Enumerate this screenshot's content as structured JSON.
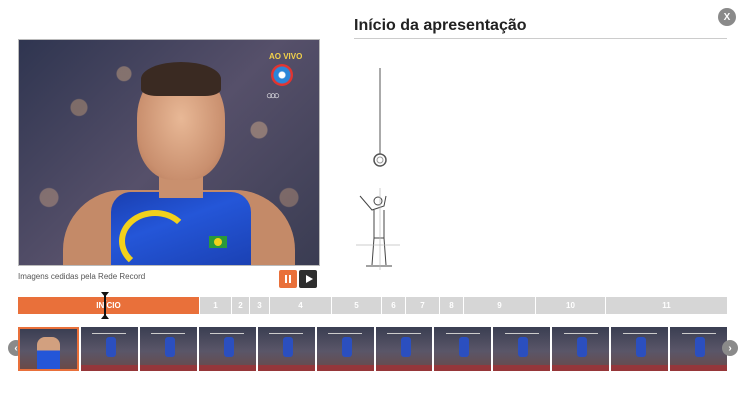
{
  "close": {
    "label": "X",
    "icon": "close-icon"
  },
  "video": {
    "live_label": "AO VIVO",
    "caption": "Imagens cedidas pela Rede Record",
    "pause_icon": "pause-icon",
    "play_icon": "play-icon"
  },
  "title": "Início da apresentação",
  "timeline": {
    "segments": [
      "INÍCIO",
      "1",
      "2",
      "3",
      "4",
      "5",
      "6",
      "7",
      "8",
      "9",
      "10",
      "11"
    ],
    "active_index": 0,
    "accent_color": "#e9703a",
    "inactive_color": "#d6d6d6"
  },
  "thumbnails": {
    "count": 12,
    "selected_index": 0
  },
  "nav": {
    "prev_icon": "chevron-left-icon",
    "next_icon": "chevron-right-icon"
  }
}
